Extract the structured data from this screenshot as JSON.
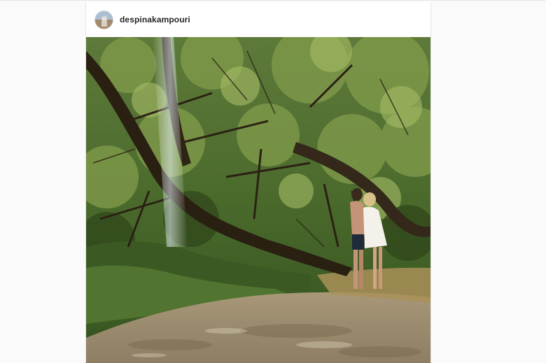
{
  "post": {
    "author": {
      "username": "despinakampouri",
      "avatar_icon": "profile-avatar"
    },
    "image": {
      "description_icon": "forest-riverbank-photo"
    }
  },
  "colors": {
    "page_background": "#fafafa",
    "card_background": "#ffffff",
    "border": "#e6e6e6",
    "username_text": "#262626"
  }
}
